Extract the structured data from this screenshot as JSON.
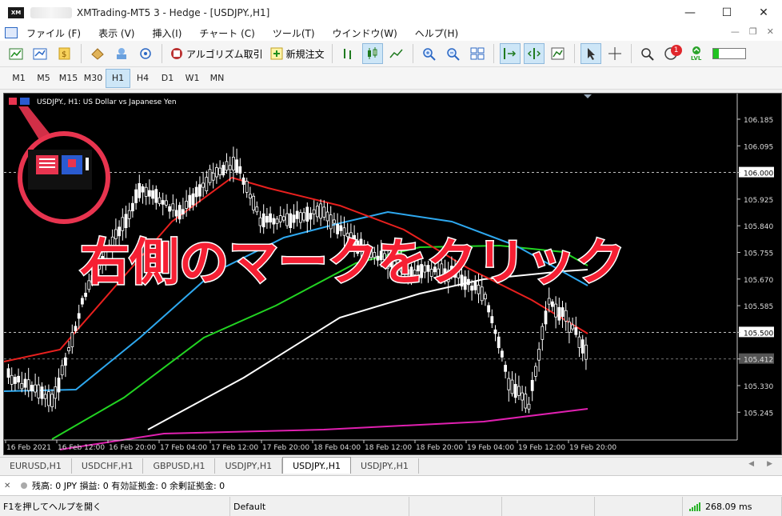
{
  "window": {
    "title": "XMTrading-MT5 3 - Hedge - [USDJPY.,H1]",
    "logo_text": "XM"
  },
  "menu": {
    "items": [
      "ファイル (F)",
      "表示 (V)",
      "挿入(I)",
      "チャート (C)",
      "ツール(T)",
      "ウインドウ(W)",
      "ヘルプ(H)"
    ]
  },
  "toolbar": {
    "algo_label": "アルゴリズム取引",
    "new_order_label": "新規注文",
    "notification_count": "1",
    "lvl_label": "LVL"
  },
  "timeframes": [
    "M1",
    "M5",
    "M15",
    "M30",
    "H1",
    "H4",
    "D1",
    "W1",
    "MN"
  ],
  "timeframe_selected": "H1",
  "chart": {
    "header": "USDJPY., H1:  US Dollar vs Japanese Yen",
    "overlay_text": "右側のマークをクリック",
    "annotation_color": "#e8344f",
    "price_labels": [
      "106.185",
      "106.095",
      "106.000",
      "105.925",
      "105.840",
      "105.755",
      "105.670",
      "105.585",
      "105.500",
      "105.412",
      "105.330",
      "105.245"
    ],
    "highlight_prices": [
      "106.000",
      "105.500",
      "105.412"
    ],
    "time_labels": [
      "16 Feb 2021",
      "16 Feb 12:00",
      "16 Feb 20:00",
      "17 Feb 04:00",
      "17 Feb 12:00",
      "17 Feb 20:00",
      "18 Feb 04:00",
      "18 Feb 12:00",
      "18 Feb 20:00",
      "19 Feb 04:00",
      "19 Feb 12:00",
      "19 Feb 20:00"
    ],
    "colors": {
      "candle": "#ffffff",
      "ma_red": "#e8201e",
      "ma_blue": "#2ea8ef",
      "ma_green": "#22d422",
      "ma_white": "#ffffff",
      "ma_magenta": "#e020b0"
    }
  },
  "tabs": {
    "items": [
      "EURUSD,H1",
      "USDCHF,H1",
      "GBPUSD,H1",
      "USDJPY,H1",
      "USDJPY.,H1",
      "USDJPY.,H1"
    ],
    "active_index": 4
  },
  "terminal": {
    "text": "残高: 0 JPY  損益: 0  有効証拠金: 0  余剰証拠金: 0"
  },
  "status": {
    "help": "F1を押してヘルプを開く",
    "profile": "Default",
    "ping": "268.09 ms"
  }
}
